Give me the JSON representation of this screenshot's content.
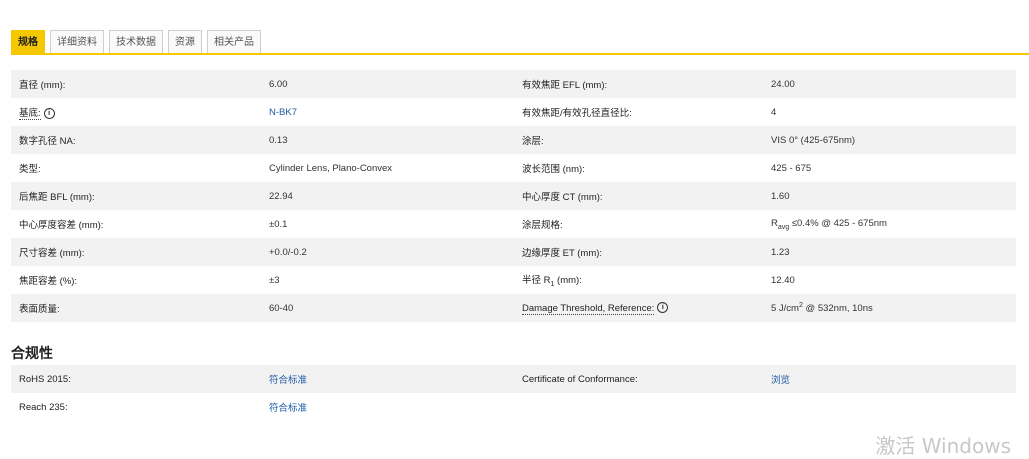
{
  "tabs": [
    {
      "label": "规格",
      "active": true
    },
    {
      "label": "详细资料",
      "active": false
    },
    {
      "label": "技术数据",
      "active": false
    },
    {
      "label": "资源",
      "active": false
    },
    {
      "label": "相关产品",
      "active": false
    }
  ],
  "specs": [
    {
      "l1": "直径 (mm):",
      "v1": "6.00",
      "l2": "有效焦距 EFL (mm):",
      "v2": "24.00"
    },
    {
      "l1": "基底:",
      "v1": "N-BK7",
      "l2": "有效焦距/有效孔径直径比:",
      "v2": "4"
    },
    {
      "l1": "数字孔径 NA:",
      "v1": "0.13",
      "l2": "涂层:",
      "v2": "VIS 0° (425-675nm)"
    },
    {
      "l1": "类型:",
      "v1": "Cylinder Lens, Plano-Convex",
      "l2": "波长范围 (nm):",
      "v2": "425 - 675"
    },
    {
      "l1": "后焦距 BFL (mm):",
      "v1": "22.94",
      "l2": "中心厚度 CT (mm):",
      "v2": "1.60"
    },
    {
      "l1": "中心厚度容差 (mm):",
      "v1": "±0.1",
      "l2": "涂层规格:",
      "v2_prefix": "R",
      "v2_sub": "avg",
      "v2": "≤0.4% @ 425 - 675nm"
    },
    {
      "l1": "尺寸容差 (mm):",
      "v1": "+0.0/-0.2",
      "l2": "边缘厚度 ET (mm):",
      "v2": "1.23"
    },
    {
      "l1": "焦距容差 (%):",
      "v1": "±3",
      "l2_prefix": "半径 R",
      "l2_sub": "1",
      "l2": " (mm):",
      "v2": "12.40"
    },
    {
      "l1": "表面质量:",
      "v1": "60-40",
      "l2": "Damage Threshold, Reference:",
      "v2_prefix": "5 J/cm",
      "v2_sup": "2",
      "v2": " @ 532nm, 10ns"
    }
  ],
  "compliance": {
    "title": "合规性",
    "rows": [
      {
        "l1": "RoHS 2015:",
        "v1": "符合标准",
        "l2": "Certificate of Conformance:",
        "v2": "浏览"
      },
      {
        "l1": "Reach 235:",
        "v1": "符合标准",
        "l2": "",
        "v2": ""
      }
    ]
  },
  "info_icon_glyph": "i",
  "watermark": "激活 Windows"
}
